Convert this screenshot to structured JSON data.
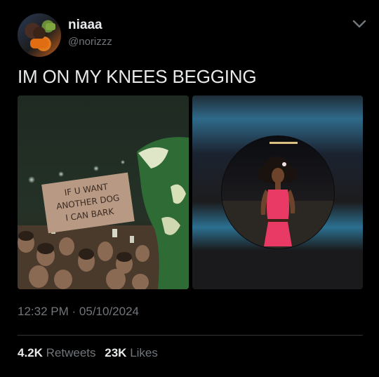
{
  "user": {
    "display_name": "niaaa",
    "handle": "@norizzz",
    "avatar_icon": "avatar-photo"
  },
  "tweet": {
    "text": "IM ON MY KNEES BEGGING",
    "time": "12:32 PM",
    "separator": "·",
    "date": "05/10/2024"
  },
  "media": {
    "left_sign_text": "IF U WANT ANOTHER DOG I CAN BARK",
    "left_description_icon": "crowd-concert-photo",
    "right_description_icon": "woman-pink-dress-photo"
  },
  "stats": {
    "retweets_count": "4.2K",
    "retweets_label": "Retweets",
    "likes_count": "23K",
    "likes_label": "Likes"
  },
  "colors": {
    "background": "#000000",
    "text_primary": "#e7e9ea",
    "text_secondary": "#71767b",
    "divider": "#2f3336"
  }
}
